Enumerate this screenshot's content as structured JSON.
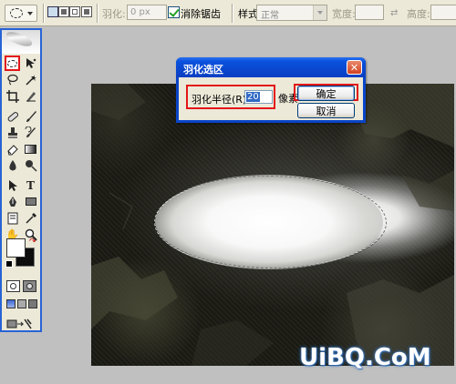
{
  "options_bar": {
    "feather_label": "羽化:",
    "feather_value": "0 px",
    "antialias_label": "消除锯齿",
    "style_label": "样式:",
    "style_value": "正常",
    "width_label": "宽度:",
    "height_label": "高度:",
    "swap_symbol": "⇄"
  },
  "dialog": {
    "title": "羽化选区",
    "close_glyph": "✕",
    "radius_label": "羽化半径(R):",
    "radius_value": "20",
    "unit": "像素",
    "ok_label": "确定",
    "cancel_label": "取消"
  },
  "toolbox": {
    "tools": [
      "marquee",
      "move",
      "lasso",
      "magic-wand",
      "crop",
      "slice",
      "healing-brush",
      "brush",
      "clone-stamp",
      "history-brush",
      "eraser",
      "gradient",
      "blur",
      "dodge",
      "path-selection",
      "type",
      "pen",
      "rectangle",
      "notes",
      "eyedropper",
      "hand",
      "zoom"
    ],
    "type_glyph": "T",
    "hand_glyph": "✋",
    "zoom_glyph": "🔍"
  },
  "watermark": "UiBQ.CoM",
  "colors": {
    "accent_red": "#e3161a",
    "xp_blue": "#0a52de",
    "panel_bg": "#ece9d8",
    "workspace_bg": "#c0c0c0"
  }
}
